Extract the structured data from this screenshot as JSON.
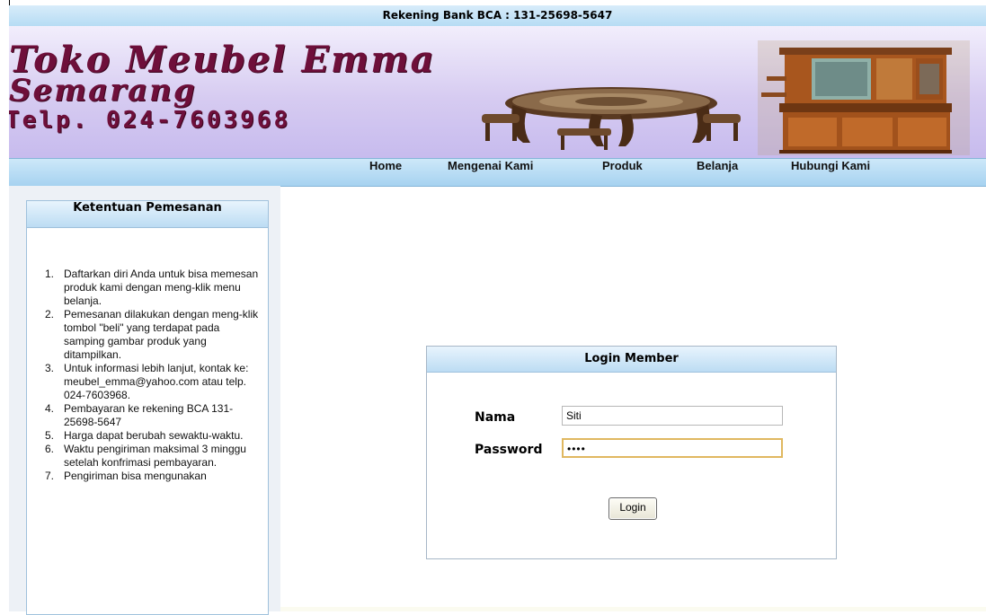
{
  "bank_bar": {
    "text": "Rekening Bank BCA : 131-25698-5647"
  },
  "banner": {
    "brand_line1": "Toko Meubel Emma",
    "brand_line2": "Semarang",
    "phone": "Telp. 024-7603968"
  },
  "nav": {
    "items": [
      {
        "label": "Home"
      },
      {
        "label": "Mengenai Kami"
      },
      {
        "label": "Produk"
      },
      {
        "label": "Belanja"
      },
      {
        "label": "Hubungi Kami"
      }
    ]
  },
  "terms": {
    "title": "Ketentuan Pemesanan",
    "items": [
      {
        "num": "1.",
        "text": "Daftarkan diri Anda untuk bisa memesan produk kami dengan meng-klik menu belanja."
      },
      {
        "num": "2.",
        "text": "Pemesanan dilakukan dengan meng-klik tombol \"beli\" yang terdapat pada samping gambar produk yang ditampilkan."
      },
      {
        "num": "3.",
        "text": "Untuk informasi lebih lanjut, kontak ke: meubel_emma@yahoo.com atau telp. 024-7603968."
      },
      {
        "num": "4.",
        "text": "Pembayaran ke rekening BCA 131-25698-5647"
      },
      {
        "num": "5.",
        "text": "Harga dapat berubah sewaktu-waktu."
      },
      {
        "num": "6.",
        "text": "Waktu pengiriman maksimal 3 minggu setelah konfrimasi pembayaran."
      },
      {
        "num": "7.",
        "text": "Pengiriman bisa mengunakan"
      }
    ]
  },
  "login": {
    "title": "Login Member",
    "name_label": "Nama",
    "name_value": "Siti",
    "password_label": "Password",
    "password_value": "••••",
    "button_label": "Login"
  },
  "colors": {
    "brand": "#6e0f3a",
    "bar_blue": "#b6dcf4",
    "banner_lavender": "#d6cbf1",
    "focus_border": "#e0b860"
  }
}
